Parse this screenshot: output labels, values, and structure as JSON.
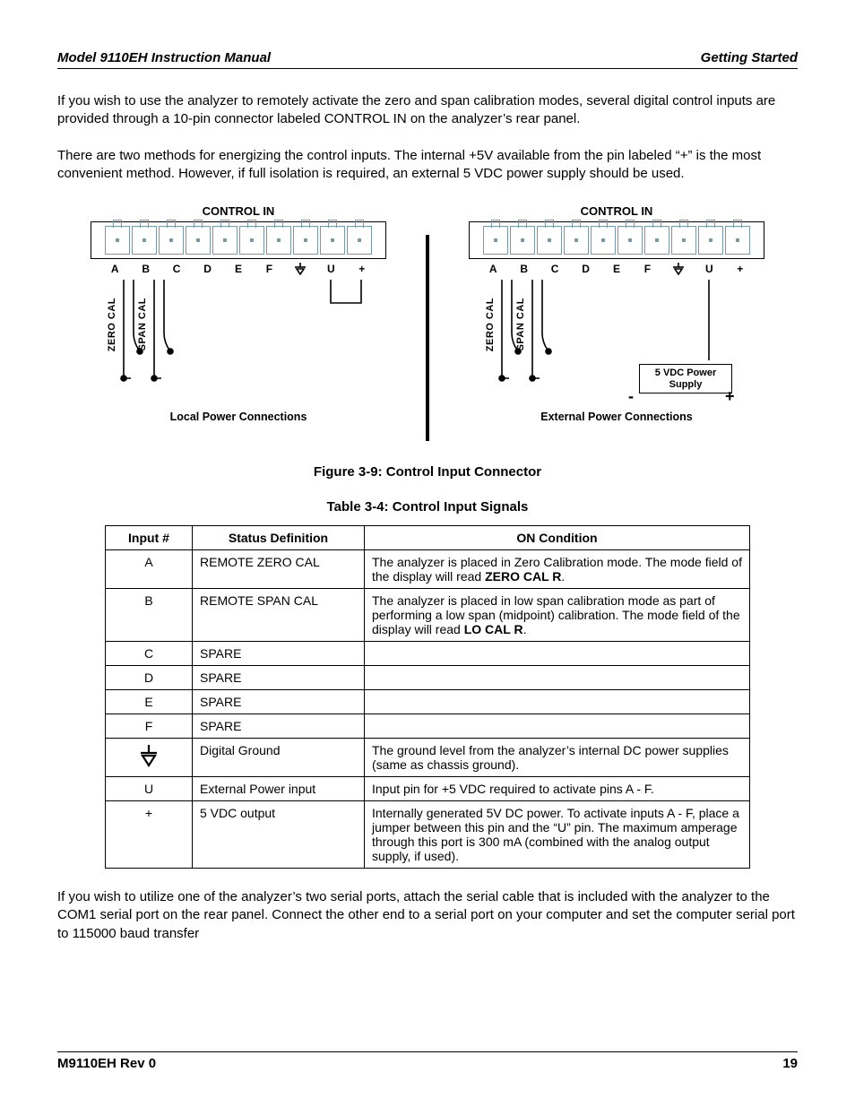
{
  "header": {
    "left": "Model 9110EH Instruction Manual",
    "right": "Getting Started"
  },
  "paragraphs": {
    "p1": "If you wish to use the analyzer to remotely activate the zero and span calibration modes, several digital control inputs are provided through a 10-pin connector labeled CONTROL IN on the analyzer’s rear panel.",
    "p2": "There are two methods for energizing the control inputs. The internal +5V available from the pin labeled “+” is the most convenient method. However, if full isolation is required, an external 5 VDC power supply should be used.",
    "p3": "If you wish to utilize one of the analyzer’s two serial ports, attach the serial cable that is included with the analyzer to the COM1 serial port on the rear panel. Connect the other end to a serial port on your computer and set the computer serial port to 115000 baud transfer"
  },
  "figure": {
    "title": "CONTROL IN",
    "pin_labels": [
      "A",
      "B",
      "C",
      "D",
      "E",
      "F",
      "⏚",
      "U",
      "+"
    ],
    "pin_label_ground_index": 6,
    "side_labels": {
      "zero": "ZERO CAL",
      "span": "SPAN CAL"
    },
    "psu": {
      "label": "5 VDC Power Supply",
      "minus": "-",
      "plus": "+"
    },
    "sub_left": "Local Power Connections",
    "sub_right": "External Power Connections",
    "caption": "Figure 3-9:   Control Input Connector"
  },
  "table": {
    "caption": "Table 3-4:    Control Input Signals",
    "headers": [
      "Input #",
      "Status Definition",
      "ON Condition"
    ],
    "rows": [
      {
        "input": "A",
        "status": "REMOTE ZERO CAL",
        "cond_pre": "The analyzer is placed in Zero Calibration mode. The mode field of the display will read ",
        "cond_bold": "ZERO CAL R",
        "cond_post": "."
      },
      {
        "input": "B",
        "status": "REMOTE SPAN CAL",
        "cond_pre": "The analyzer is placed in low span calibration mode as part of performing a low span (midpoint) calibration. The mode field of the display will read ",
        "cond_bold": "LO CAL R",
        "cond_post": "."
      },
      {
        "input": "C",
        "status": "SPARE",
        "cond_pre": "",
        "cond_bold": "",
        "cond_post": ""
      },
      {
        "input": "D",
        "status": "SPARE",
        "cond_pre": "",
        "cond_bold": "",
        "cond_post": ""
      },
      {
        "input": "E",
        "status": "SPARE",
        "cond_pre": "",
        "cond_bold": "",
        "cond_post": ""
      },
      {
        "input": "F",
        "status": "SPARE",
        "cond_pre": "",
        "cond_bold": "",
        "cond_post": ""
      },
      {
        "input": "__GND__",
        "status": "Digital Ground",
        "cond_pre": "The ground level from the analyzer’s internal DC power supplies (same as chassis ground).",
        "cond_bold": "",
        "cond_post": ""
      },
      {
        "input": "U",
        "status": "External Power input",
        "cond_pre": "Input pin for +5 VDC required to activate pins A - F.",
        "cond_bold": "",
        "cond_post": ""
      },
      {
        "input": "+",
        "status": "5 VDC output",
        "cond_pre": "Internally generated 5V DC power. To activate inputs A - F, place a jumper between this pin and the “U” pin. The maximum amperage through this port is 300 mA (combined with the analog output supply, if used).",
        "cond_bold": "",
        "cond_post": ""
      }
    ]
  },
  "footer": {
    "left": "M9110EH Rev 0",
    "right": "19"
  }
}
